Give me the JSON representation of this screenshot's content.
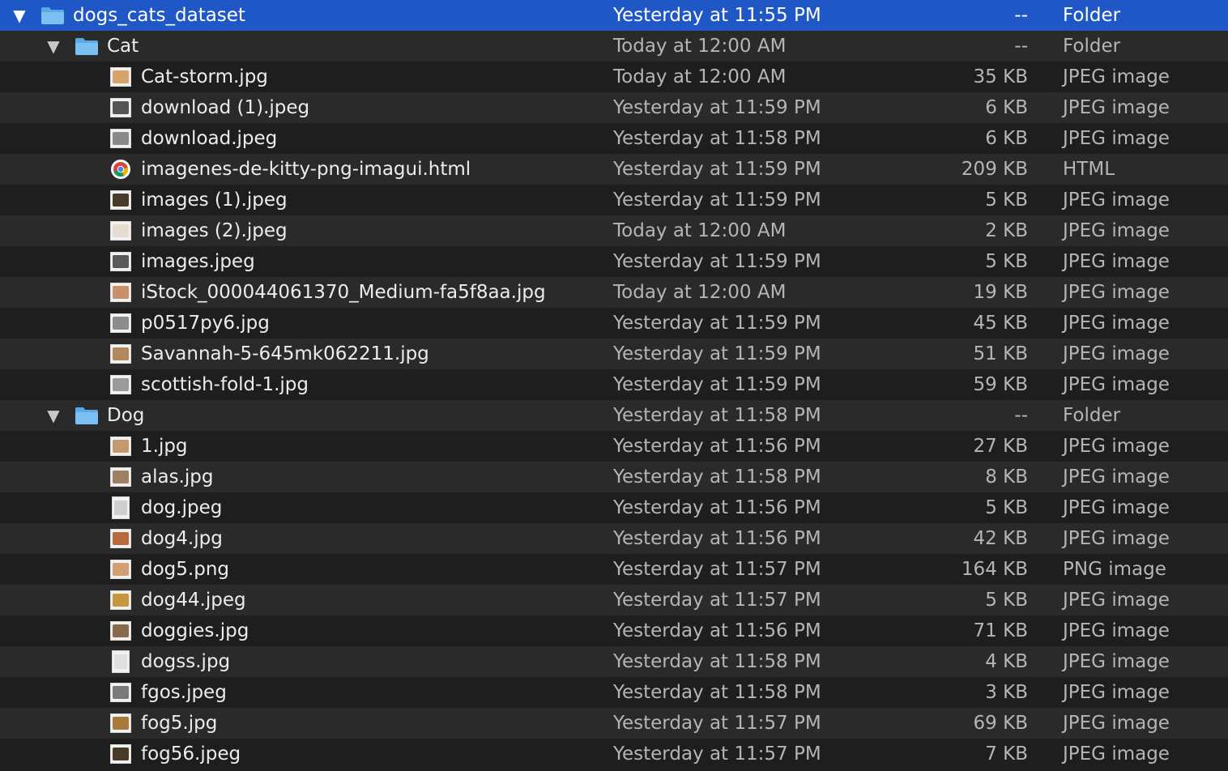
{
  "colors": {
    "selected": "#1f57c7",
    "row_odd": "#2a2a2a",
    "row_even": "#1e1e1e",
    "folder": "#5aa9e6"
  },
  "rows": [
    {
      "name": "dogs_cats_dataset",
      "date": "Yesterday at 11:55 PM",
      "size": "--",
      "kind": "Folder",
      "level": 0,
      "type": "folder",
      "expanded": true,
      "selected": true
    },
    {
      "name": "Cat",
      "date": "Today at 12:00 AM",
      "size": "--",
      "kind": "Folder",
      "level": 1,
      "type": "folder",
      "expanded": true
    },
    {
      "name": "Cat-storm.jpg",
      "date": "Today at 12:00 AM",
      "size": "35 KB",
      "kind": "JPEG image",
      "level": 2,
      "type": "image",
      "tint": "#d8a36a"
    },
    {
      "name": "download (1).jpeg",
      "date": "Yesterday at 11:59 PM",
      "size": "6 KB",
      "kind": "JPEG image",
      "level": 2,
      "type": "image",
      "tint": "#555555"
    },
    {
      "name": "download.jpeg",
      "date": "Yesterday at 11:58 PM",
      "size": "6 KB",
      "kind": "JPEG image",
      "level": 2,
      "type": "image",
      "tint": "#8a8a8a"
    },
    {
      "name": "imagenes-de-kitty-png-imagui.html",
      "date": "Yesterday at 11:59 PM",
      "size": "209 KB",
      "kind": "HTML",
      "level": 2,
      "type": "html"
    },
    {
      "name": "images (1).jpeg",
      "date": "Yesterday at 11:59 PM",
      "size": "5 KB",
      "kind": "JPEG image",
      "level": 2,
      "type": "image",
      "tint": "#4a3a2a"
    },
    {
      "name": "images (2).jpeg",
      "date": "Today at 12:00 AM",
      "size": "2 KB",
      "kind": "JPEG image",
      "level": 2,
      "type": "image",
      "tint": "#e6dccf"
    },
    {
      "name": "images.jpeg",
      "date": "Yesterday at 11:59 PM",
      "size": "5 KB",
      "kind": "JPEG image",
      "level": 2,
      "type": "image",
      "tint": "#5a5a5a"
    },
    {
      "name": "iStock_000044061370_Medium-fa5f8aa.jpg",
      "date": "Today at 12:00 AM",
      "size": "19 KB",
      "kind": "JPEG image",
      "level": 2,
      "type": "image",
      "tint": "#c9906a"
    },
    {
      "name": "p0517py6.jpg",
      "date": "Yesterday at 11:59 PM",
      "size": "45 KB",
      "kind": "JPEG image",
      "level": 2,
      "type": "image",
      "tint": "#8c8c8c"
    },
    {
      "name": "Savannah-5-645mk062211.jpg",
      "date": "Yesterday at 11:59 PM",
      "size": "51 KB",
      "kind": "JPEG image",
      "level": 2,
      "type": "image",
      "tint": "#b08a5a"
    },
    {
      "name": "scottish-fold-1.jpg",
      "date": "Yesterday at 11:59 PM",
      "size": "59 KB",
      "kind": "JPEG image",
      "level": 2,
      "type": "image",
      "tint": "#9a9a9a"
    },
    {
      "name": "Dog",
      "date": "Yesterday at 11:58 PM",
      "size": "--",
      "kind": "Folder",
      "level": 1,
      "type": "folder",
      "expanded": true
    },
    {
      "name": "1.jpg",
      "date": "Yesterday at 11:56 PM",
      "size": "27 KB",
      "kind": "JPEG image",
      "level": 2,
      "type": "image",
      "tint": "#c49a6c"
    },
    {
      "name": "alas.jpg",
      "date": "Yesterday at 11:58 PM",
      "size": "8 KB",
      "kind": "JPEG image",
      "level": 2,
      "type": "image",
      "tint": "#a08060"
    },
    {
      "name": "dog.jpeg",
      "date": "Yesterday at 11:56 PM",
      "size": "5 KB",
      "kind": "JPEG image",
      "level": 2,
      "type": "image",
      "tint": "#cfcfcf",
      "tall": true
    },
    {
      "name": "dog4.jpg",
      "date": "Yesterday at 11:56 PM",
      "size": "42 KB",
      "kind": "JPEG image",
      "level": 2,
      "type": "image",
      "tint": "#b86a3a"
    },
    {
      "name": "dog5.png",
      "date": "Yesterday at 11:57 PM",
      "size": "164 KB",
      "kind": "PNG image",
      "level": 2,
      "type": "image",
      "tint": "#d2a070"
    },
    {
      "name": "dog44.jpeg",
      "date": "Yesterday at 11:57 PM",
      "size": "5 KB",
      "kind": "JPEG image",
      "level": 2,
      "type": "image",
      "tint": "#c8963c"
    },
    {
      "name": "doggies.jpg",
      "date": "Yesterday at 11:56 PM",
      "size": "71 KB",
      "kind": "JPEG image",
      "level": 2,
      "type": "image",
      "tint": "#8a6a4a"
    },
    {
      "name": "dogss.jpg",
      "date": "Yesterday at 11:58 PM",
      "size": "4 KB",
      "kind": "JPEG image",
      "level": 2,
      "type": "image",
      "tint": "#e0e0e0",
      "tall": true
    },
    {
      "name": "fgos.jpeg",
      "date": "Yesterday at 11:58 PM",
      "size": "3 KB",
      "kind": "JPEG image",
      "level": 2,
      "type": "image",
      "tint": "#7a7a7a"
    },
    {
      "name": "fog5.jpg",
      "date": "Yesterday at 11:57 PM",
      "size": "69 KB",
      "kind": "JPEG image",
      "level": 2,
      "type": "image",
      "tint": "#a87a3a"
    },
    {
      "name": "fog56.jpeg",
      "date": "Yesterday at 11:57 PM",
      "size": "7 KB",
      "kind": "JPEG image",
      "level": 2,
      "type": "image",
      "tint": "#4a3a2a"
    }
  ]
}
